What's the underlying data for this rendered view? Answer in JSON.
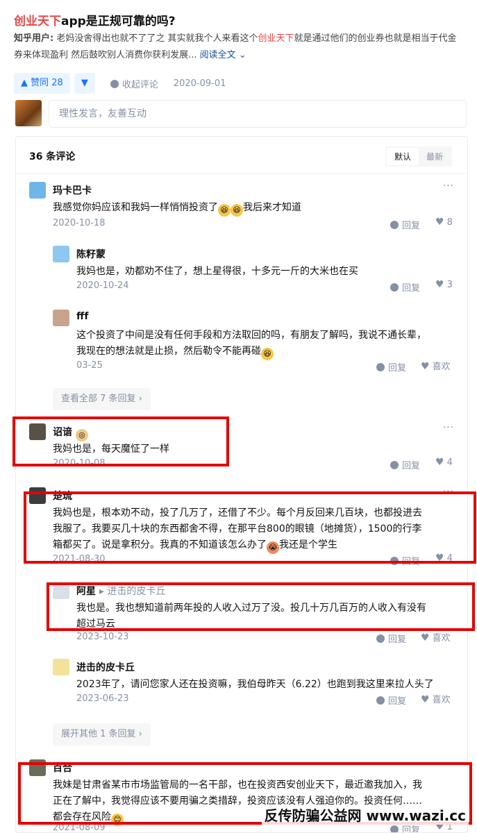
{
  "question": {
    "title_highlight": "创业天下",
    "title_rest": "app是正规可靠的吗?"
  },
  "answer": {
    "author_label": "知乎用户:",
    "part1": " 老妈没舍得出也就不了了之 其实就我个人来看这个",
    "highlight": "创业天下",
    "part2": "就是通过他们的创业券也就是相当于代金券来体现盈利 然后鼓吹别人消费你获利发展...",
    "read_more": " 阅读全文 ⌄"
  },
  "actions": {
    "upvote": "▲ 赞同 28",
    "downvote": "▼",
    "collapse": "收起评论",
    "date": "2020-09-01"
  },
  "compose": {
    "placeholder": "理性发言，友善互动"
  },
  "comments_panel": {
    "count": "36 条评论",
    "sort_default": "默认",
    "sort_latest": "最新"
  },
  "comments": {
    "c1": {
      "name": "玛卡巴卡",
      "text": "我感觉你妈应该和我妈一样悄悄投资了",
      "text_tail": "我后来才知道",
      "date": "2020-10-18",
      "reply": "回复",
      "likes": "8"
    },
    "c1r1": {
      "name": "陈籽蒙",
      "text": "我妈也是，劝都劝不住了，想上星得很，十多元一斤的大米也在买",
      "date": "2020-10-24",
      "reply": "回复",
      "likes": "3"
    },
    "c1r2": {
      "name": "fff",
      "text_line1": "这个投资了中间是没有任何手段和方法取回的吗，有朋友了解吗，我说不通长辈，",
      "text_line2": "我现在的想法就是止损，然后勒令不能再碰",
      "date": "03-25",
      "reply": "回复",
      "like_label": "喜欢"
    },
    "c1_more": "查看全部 7 条回复 ›",
    "c2": {
      "name": "诏谙",
      "text": "我妈也是，每天魔怔了一样",
      "date": "2020-10-08",
      "reply": "回复",
      "likes": "4"
    },
    "c3": {
      "name": "楚琉",
      "text_line1": "我妈也是，根本劝不动，投了几万了，还借了不少。每个月反回来几百块，也都投进去",
      "text_line2": "我服了。我要买几十块的东西都舍不得，在那平台800的眼镜（地摊货），1500的行李",
      "text_line3": "箱都买了。说是拿积分。我真的不知道该怎么办了",
      "text_tail": "我还是个学生",
      "date": "2021-08-30",
      "reply": "回复",
      "likes": "4"
    },
    "c3r1": {
      "name": "阿星",
      "reply_to": "▸ 进击的皮卡丘",
      "text_line1": "我也是。我也想知道前两年投的人收入过万了没。投几十万几百万的人收入有没有",
      "text_line2": "超过马云",
      "date": "2023-10-23",
      "reply": "回复",
      "like_label": "喜欢"
    },
    "c3r2": {
      "name": "进击的皮卡丘",
      "text": "2023年了，请问您家人还在投资嘛，我伯母昨天（6.22）也跑到我这里来拉人头了",
      "date": "2023-06-23",
      "reply": "回复",
      "like_label": "喜欢"
    },
    "c3_more": "展开其他 1 条回复 ›",
    "c4": {
      "name": "百合",
      "text_line1": "我妹是甘肃省某市市场监管局的一名干部，也在投资西安创业天下，最近邀我加入，我",
      "text_line2": "正在了解中，我觉得应该不要用骗之类措辞，投资应该没有人强迫你的。投资任何……",
      "text_line3": "都会存在风险",
      "date": "2021-08-09",
      "reply": "回复",
      "likes": "1"
    }
  },
  "more_glyph": "···",
  "watermark": "反传防骗公益网 www.wazi.cc"
}
